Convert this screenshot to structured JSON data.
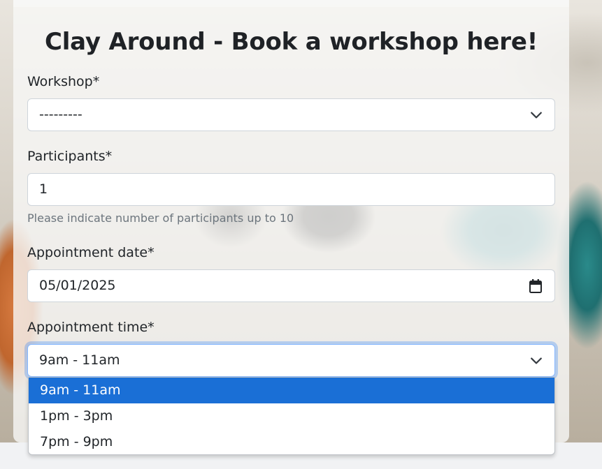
{
  "form": {
    "title": "Clay Around - Book a workshop here!",
    "workshop": {
      "label": "Workshop*",
      "value": "---------"
    },
    "participants": {
      "label": "Participants*",
      "value": "1",
      "help": "Please indicate number of participants up to 10"
    },
    "date": {
      "label": "Appointment date*",
      "value": "05/01/2025"
    },
    "time": {
      "label": "Appointment time*",
      "value": "9am - 11am",
      "options": [
        "9am - 11am",
        "1pm - 3pm",
        "7pm - 9pm"
      ],
      "selected_index": 0
    }
  },
  "icons": {
    "select": "chevron-down-icon",
    "date": "calendar-icon"
  },
  "colors": {
    "selected_option": "#1a6fd6",
    "focus_ring": "#86b7fe"
  }
}
